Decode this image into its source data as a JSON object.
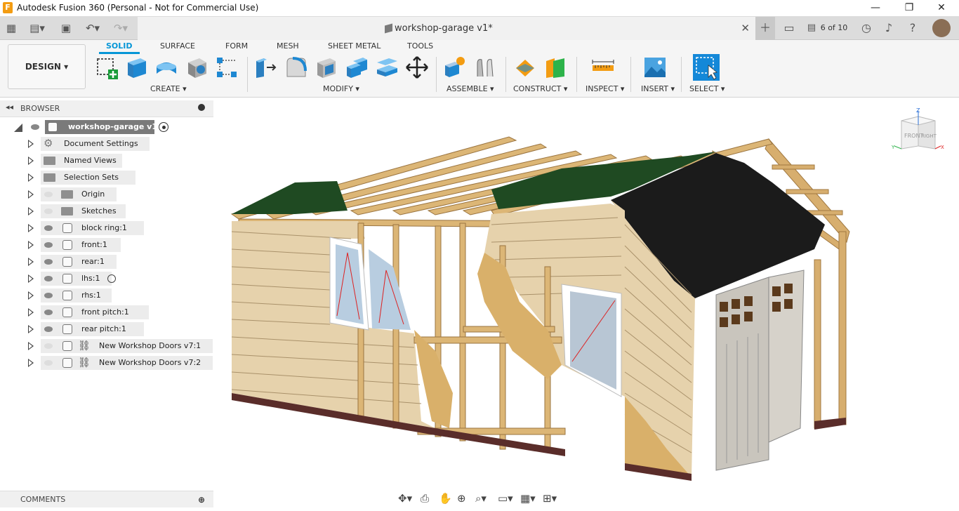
{
  "window": {
    "title": "Autodesk Fusion 360 (Personal - Not for Commercial Use)",
    "app_icon": "F"
  },
  "document": {
    "tab_title": "workshop-garage v1*",
    "jobs": "6 of 10"
  },
  "workspace": {
    "label": "DESIGN ▾"
  },
  "ribbon": {
    "tabs": [
      "SOLID",
      "SURFACE",
      "FORM",
      "MESH",
      "SHEET METAL",
      "TOOLS"
    ],
    "active_tab": "SOLID",
    "groups": [
      "CREATE ▾",
      "MODIFY ▾",
      "ASSEMBLE ▾",
      "CONSTRUCT ▾",
      "INSPECT ▾",
      "INSERT ▾",
      "SELECT ▾"
    ]
  },
  "browser": {
    "title": "BROWSER",
    "root": "workshop-garage v1",
    "items": [
      {
        "label": "Document Settings",
        "icon": "gear-icon",
        "visible": true
      },
      {
        "label": "Named Views",
        "icon": "folder-icon",
        "visible": true
      },
      {
        "label": "Selection Sets",
        "icon": "folder-icon",
        "visible": true
      },
      {
        "label": "Origin",
        "icon": "folder-icon",
        "visible": false
      },
      {
        "label": "Sketches",
        "icon": "folder-icon",
        "visible": false
      },
      {
        "label": "block ring:1",
        "icon": "body-icon",
        "visible": true
      },
      {
        "label": "front:1",
        "icon": "component-icon",
        "visible": true
      },
      {
        "label": "rear:1",
        "icon": "component-icon",
        "visible": true
      },
      {
        "label": "lhs:1",
        "icon": "component-icon",
        "visible": true
      },
      {
        "label": "rhs:1",
        "icon": "component-icon",
        "visible": true
      },
      {
        "label": "front pitch:1",
        "icon": "component-icon",
        "visible": true
      },
      {
        "label": "rear pitch:1",
        "icon": "component-icon",
        "visible": true
      },
      {
        "label": "New Workshop Doors v7:1",
        "icon": "link-icon",
        "visible": false
      },
      {
        "label": "New Workshop Doors v7:2",
        "icon": "link-icon",
        "visible": false
      }
    ]
  },
  "comments": {
    "title": "COMMENTS"
  },
  "viewcube": {
    "front": "FRONT",
    "right": "RIGHT",
    "z": "Z",
    "x": "X",
    "y": "Y"
  },
  "colors": {
    "accent": "#0696d7",
    "wood": "#e6d2ac",
    "timber": "#d7ae6e",
    "roof": "#1b1b1b",
    "shingle_green": "#1f4a22"
  }
}
